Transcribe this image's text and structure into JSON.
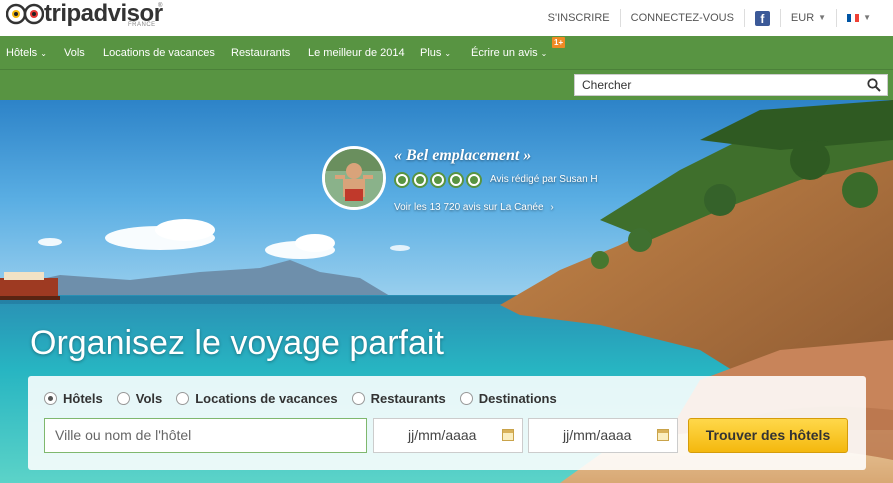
{
  "brand": {
    "name": "tripadvisor",
    "sub": "FRANCE",
    "reg": "®"
  },
  "topnav": {
    "signup": "S'INSCRIRE",
    "login": "CONNECTEZ-VOUS",
    "facebook": "f",
    "currency": "EUR"
  },
  "nav": {
    "items": [
      "Hôtels",
      "Vols",
      "Locations de vacances",
      "Restaurants",
      "Le meilleur de 2014",
      "Plus",
      "Écrire un avis"
    ],
    "badge": "1+"
  },
  "search": {
    "placeholder": "Chercher"
  },
  "review": {
    "quote": "« Bel emplacement »",
    "rating": 5,
    "author": "Avis rédigé par Susan H",
    "see_all": "Voir les 13 720 avis sur La Canée",
    "see_all_arrow": "›"
  },
  "hero": {
    "title": "Organisez le voyage parfait"
  },
  "booking": {
    "options": [
      {
        "label": "Hôtels",
        "selected": true
      },
      {
        "label": "Vols",
        "selected": false
      },
      {
        "label": "Locations de vacances",
        "selected": false
      },
      {
        "label": "Restaurants",
        "selected": false
      },
      {
        "label": "Destinations",
        "selected": false
      }
    ],
    "city_placeholder": "Ville ou nom de l'hôtel",
    "checkin_placeholder": "jj/mm/aaaa",
    "checkout_placeholder": "jj/mm/aaaa",
    "submit": "Trouver des hôtels"
  },
  "colors": {
    "green": "#589442",
    "accent": "#f4b80e",
    "badge": "#f08a24"
  }
}
